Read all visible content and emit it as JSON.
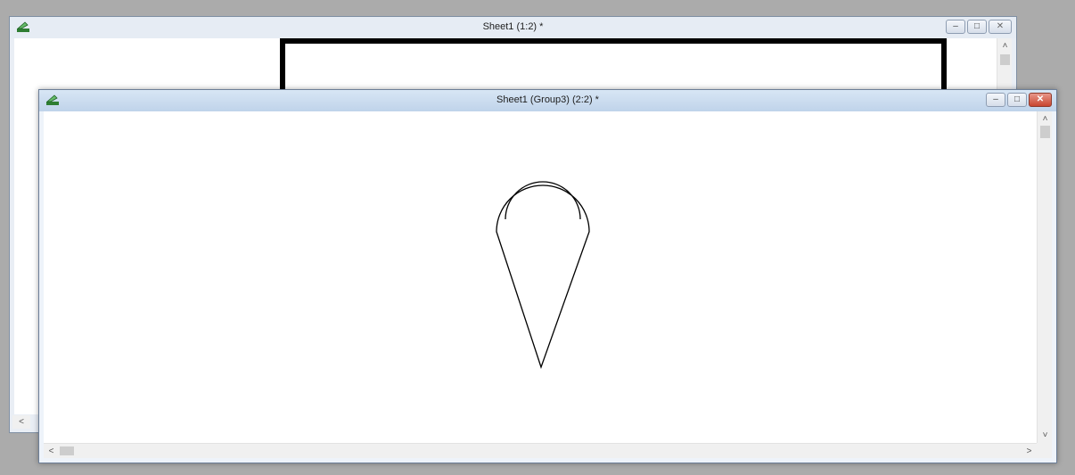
{
  "windows": [
    {
      "title": "Sheet1 (1:2) *",
      "controls": {
        "minimize": "–",
        "maximize": "□",
        "close": "✕"
      }
    },
    {
      "title": "Sheet1 (Group3) (2:2) *",
      "controls": {
        "minimize": "–",
        "maximize": "□",
        "close": "✕"
      }
    }
  ],
  "scroll_glyphs": {
    "up": "˄",
    "down": "˅",
    "left": "<",
    "right": ">"
  },
  "icons": {
    "app": "drawing-app-icon",
    "shape": "map-pin-shape"
  },
  "colors": {
    "desktop": "#ababab",
    "titlebar_active": "#bfd3ea",
    "close_active": "#c9452f",
    "frame_stroke": "#000000"
  }
}
